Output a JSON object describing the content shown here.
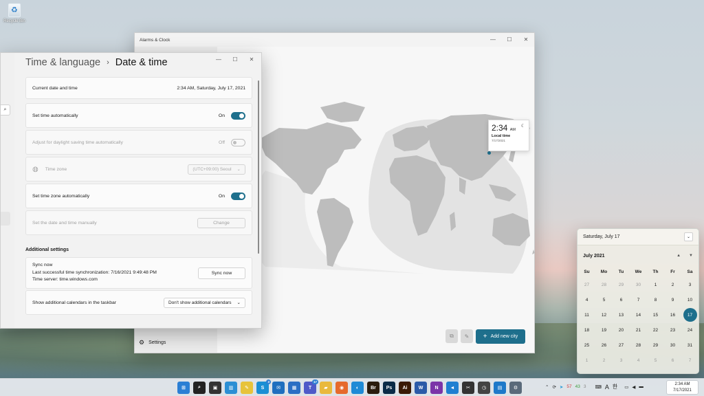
{
  "desktop": {
    "recycle_bin_label": "Recycle Bin"
  },
  "alarms_window": {
    "title": "Alarms & Clock",
    "nav_settings_label": "Settings",
    "time_card": {
      "time": "2:34",
      "ampm": "AM",
      "label": "Local time",
      "date": "7/17/2021"
    },
    "add_city_label": "Add new city"
  },
  "settings_window": {
    "breadcrumb_parent": "Time & language",
    "breadcrumb_current": "Date & time",
    "rows": {
      "current": {
        "label": "Current date and time",
        "value": "2:34 AM, Saturday, July 17, 2021"
      },
      "set_auto": {
        "label": "Set time automatically",
        "state": "On"
      },
      "dst": {
        "label": "Adjust for daylight saving time automatically",
        "state": "Off"
      },
      "tz": {
        "label": "Time zone",
        "value": "(UTC+09:00) Seoul"
      },
      "tz_auto": {
        "label": "Set time zone automatically",
        "state": "On"
      },
      "manual": {
        "label": "Set the date and time manually",
        "button": "Change"
      }
    },
    "additional_heading": "Additional settings",
    "sync": {
      "title": "Sync now",
      "last": "Last successful time synchronization: 7/16/2021 9:49:48 PM",
      "server": "Time server: time.windows.com",
      "button": "Sync now"
    },
    "calendars": {
      "label": "Show additional calendars in the taskbar",
      "value": "Don't show additional calendars"
    }
  },
  "calendar_flyout": {
    "header": "Saturday, July 17",
    "month": "July 2021",
    "weekdays": [
      "Su",
      "Mo",
      "Tu",
      "We",
      "Th",
      "Fr",
      "Sa"
    ],
    "days": [
      "27",
      "28",
      "29",
      "30",
      "1",
      "2",
      "3",
      "4",
      "5",
      "6",
      "7",
      "8",
      "9",
      "10",
      "11",
      "12",
      "13",
      "14",
      "15",
      "16",
      "17",
      "18",
      "19",
      "20",
      "21",
      "22",
      "23",
      "24",
      "25",
      "26",
      "27",
      "28",
      "29",
      "30",
      "31",
      "1",
      "2",
      "3",
      "4",
      "5",
      "6",
      "7"
    ],
    "other_month_indexes": [
      0,
      1,
      2,
      3,
      35,
      36,
      37,
      38,
      39,
      40,
      41
    ],
    "today_index": 20
  },
  "taskbar": {
    "apps": [
      {
        "name": "start",
        "glyph": "⊞",
        "color": "#2b7fd4"
      },
      {
        "name": "search",
        "glyph": "⌕",
        "color": "#222222"
      },
      {
        "name": "task-view",
        "glyph": "▣",
        "color": "#333333"
      },
      {
        "name": "widgets",
        "glyph": "▥",
        "color": "#2b8fd4"
      },
      {
        "name": "sticky-notes",
        "glyph": "✎",
        "color": "#e7c33a"
      },
      {
        "name": "skype",
        "glyph": "S",
        "color": "#1a8fd4",
        "badge": "3"
      },
      {
        "name": "mail",
        "glyph": "✉",
        "color": "#1f6fbf"
      },
      {
        "name": "calendar",
        "glyph": "▦",
        "color": "#2b6fc4"
      },
      {
        "name": "teams",
        "glyph": "T",
        "color": "#4f5ac8",
        "badge": "17"
      },
      {
        "name": "file-explorer",
        "glyph": "▰",
        "color": "#e9b93c"
      },
      {
        "name": "firefox",
        "glyph": "◉",
        "color": "#e66a2c"
      },
      {
        "name": "edge",
        "glyph": "◐",
        "color": "#1e8ad6"
      },
      {
        "name": "bridge",
        "glyph": "Br",
        "color": "#2a1c0e"
      },
      {
        "name": "photoshop",
        "glyph": "Ps",
        "color": "#0a2b47"
      },
      {
        "name": "illustrator",
        "glyph": "Ai",
        "color": "#3a1a05"
      },
      {
        "name": "word",
        "glyph": "W",
        "color": "#2b5ba8"
      },
      {
        "name": "onenote",
        "glyph": "N",
        "color": "#7b34a8"
      },
      {
        "name": "vscode",
        "glyph": "◄",
        "color": "#1f7fd1"
      },
      {
        "name": "snipping",
        "glyph": "✂",
        "color": "#333333"
      },
      {
        "name": "clock",
        "glyph": "◷",
        "color": "#444444"
      },
      {
        "name": "remote-desktop",
        "glyph": "▤",
        "color": "#1e79c9"
      },
      {
        "name": "settings",
        "glyph": "⚙",
        "color": "#5a6a7a"
      }
    ],
    "tray": {
      "count1": "57",
      "count2": "43",
      "count3": "3",
      "ime1": "A",
      "ime2": "한"
    },
    "clock_time": "2:34 AM",
    "clock_date": "7/17/2021"
  }
}
